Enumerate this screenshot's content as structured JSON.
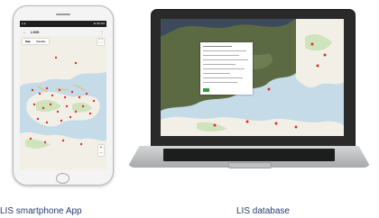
{
  "captions": {
    "phone": "LIS smartphone App",
    "laptop": "LIS database"
  },
  "phone": {
    "status_time": "11:58 AM",
    "app_title": "LMIS",
    "menu_icon": "←",
    "overflow_icon": "⋮",
    "map_type_options": [
      "Map",
      "Satellite"
    ],
    "fullscreen_icon": "⛶",
    "zoom_in": "+",
    "zoom_out": "−"
  },
  "colors": {
    "caption_text": "#263b6f",
    "water": "#c6dbe8",
    "land": "#f2efe6",
    "green_land": "#cfe3bc",
    "marker": "#d9342b",
    "satellite_land": "#5c6a44",
    "satellite_water": "#3c4a5c"
  },
  "icons": {
    "map_marker": "map-pin-icon",
    "menu": "arrow-left-icon",
    "overflow": "more-vertical-icon",
    "fullscreen": "fullscreen-icon"
  }
}
